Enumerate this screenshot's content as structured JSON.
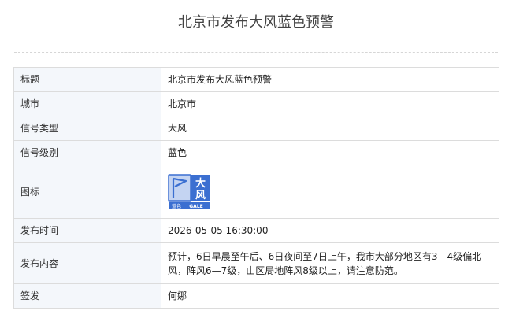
{
  "page": {
    "title": "北京市发布大风蓝色预警"
  },
  "table": {
    "rows": [
      {
        "label": "标题",
        "value": "北京市发布大风蓝色预警"
      },
      {
        "label": "城市",
        "value": "北京市"
      },
      {
        "label": "信号类型",
        "value": "大风"
      },
      {
        "label": "信号级别",
        "value": "蓝色"
      },
      {
        "label": "图标"
      },
      {
        "label": "发布时间",
        "value": "2026-05-05 16:30:00"
      },
      {
        "label": "发布内容",
        "value": "预计，6日早晨至午后、6日夜间至7日上午，我市大部分地区有3—4级偏北风，阵风6—7级，山区局地阵风8级以上，请注意防范。"
      },
      {
        "label": "签发",
        "value": "何娜"
      }
    ]
  },
  "icon": {
    "name": "gale-blue-warning-icon",
    "big_text_1": "大",
    "big_text_2": "风",
    "level_text": "蓝色",
    "english_text": "GALE",
    "colors": {
      "blue": "#3b6fd1",
      "light": "#c4d4f2",
      "white": "#ffffff"
    }
  },
  "colors": {
    "label_bg": "#f4f7fb",
    "border": "#dcdcdc",
    "divider": "#d6d6d6"
  }
}
